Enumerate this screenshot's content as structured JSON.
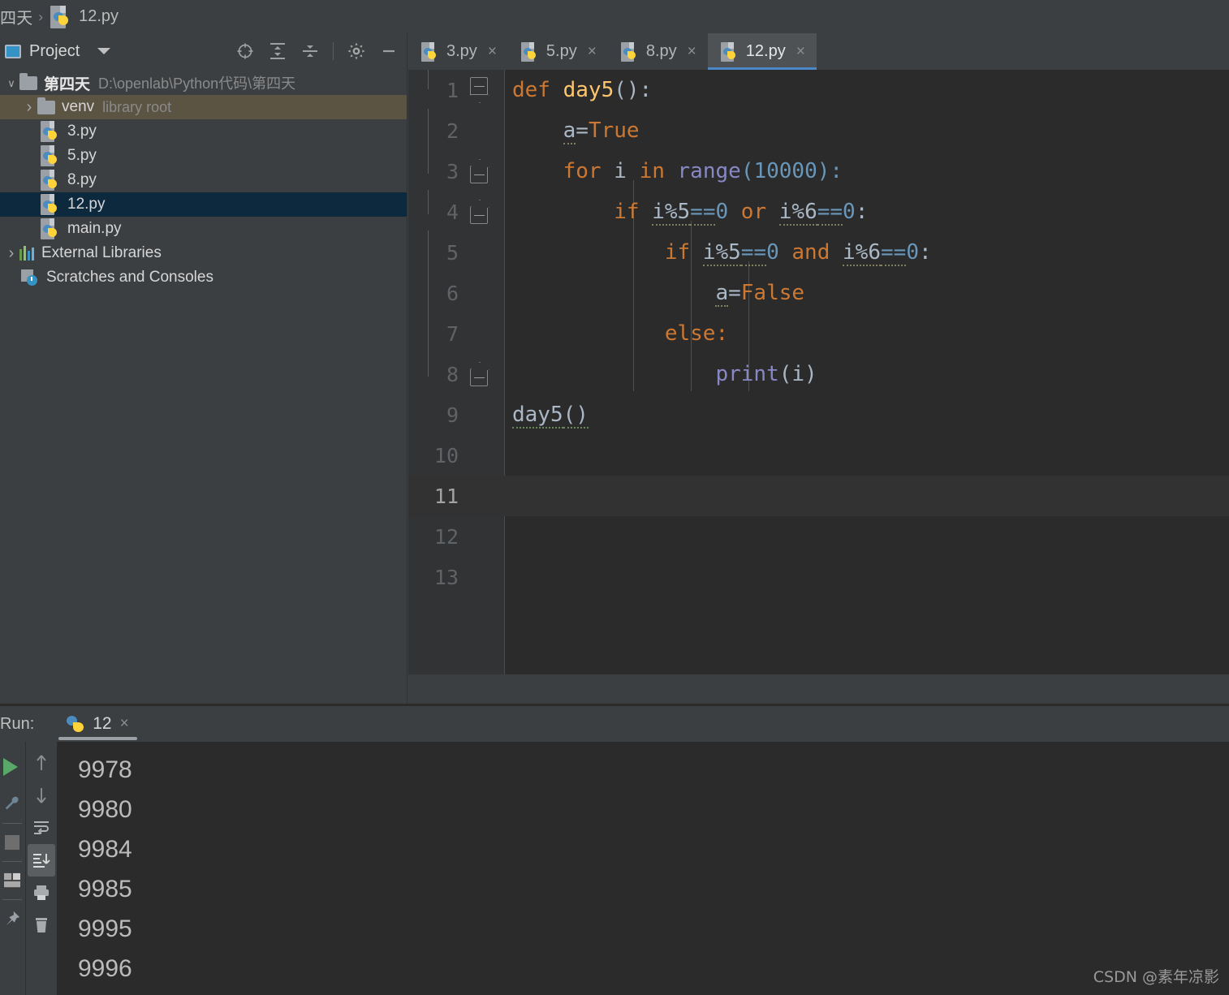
{
  "breadcrumb": {
    "folder": "四天",
    "separator": "›",
    "file": "12.py",
    "file_icon": "python-file-icon"
  },
  "project_panel": {
    "title": "Project",
    "window_icon": "project-window-icon",
    "caret_icon": "chevron-down-icon",
    "tools": [
      {
        "name": "locate-icon",
        "label": "Select Opened File"
      },
      {
        "name": "expand-all-icon",
        "label": "Expand All"
      },
      {
        "name": "collapse-all-icon",
        "label": "Collapse All"
      },
      {
        "name": "gear-icon",
        "label": "Settings"
      },
      {
        "name": "minimize-icon",
        "label": "Hide"
      }
    ],
    "tree": [
      {
        "label": "第四天",
        "detail": "D:\\openlab\\Python代码\\第四天",
        "icon": "folder-icon",
        "arrow": "down",
        "depth": 0,
        "bold": true,
        "state": "normal"
      },
      {
        "label": "venv",
        "detail": "library root",
        "icon": "folder-icon",
        "arrow": "right",
        "depth": 1,
        "bold": false,
        "state": "hover"
      },
      {
        "label": "3.py",
        "detail": "",
        "icon": "python-file-icon",
        "arrow": "none",
        "depth": 2,
        "bold": false,
        "state": "normal"
      },
      {
        "label": "5.py",
        "detail": "",
        "icon": "python-file-icon",
        "arrow": "none",
        "depth": 2,
        "bold": false,
        "state": "normal"
      },
      {
        "label": "8.py",
        "detail": "",
        "icon": "python-file-icon",
        "arrow": "none",
        "depth": 2,
        "bold": false,
        "state": "normal"
      },
      {
        "label": "12.py",
        "detail": "",
        "icon": "python-file-icon",
        "arrow": "none",
        "depth": 2,
        "bold": false,
        "state": "selected"
      },
      {
        "label": "main.py",
        "detail": "",
        "icon": "python-file-icon",
        "arrow": "none",
        "depth": 2,
        "bold": false,
        "state": "normal"
      },
      {
        "label": "External Libraries",
        "detail": "",
        "icon": "libraries-icon",
        "arrow": "right",
        "depth": 0,
        "bold": false,
        "state": "normal"
      },
      {
        "label": "Scratches and Consoles",
        "detail": "",
        "icon": "scratches-icon",
        "arrow": "none",
        "depth": 1,
        "bold": false,
        "state": "normal"
      }
    ]
  },
  "editor": {
    "tabs": [
      {
        "label": "3.py",
        "active": false,
        "close": "×"
      },
      {
        "label": "5.py",
        "active": false,
        "close": "×"
      },
      {
        "label": "8.py",
        "active": false,
        "close": "×"
      },
      {
        "label": "12.py",
        "active": true,
        "close": "×"
      }
    ],
    "caret_line": 11,
    "total_lines": 13,
    "line_numbers": [
      "1",
      "2",
      "3",
      "4",
      "5",
      "6",
      "7",
      "8",
      "9",
      "10",
      "11",
      "12",
      "13"
    ],
    "code": [
      {
        "n": "1",
        "text": "def day5():"
      },
      {
        "n": "2",
        "text": "    a=True"
      },
      {
        "n": "3",
        "text": "    for i in range(10000):"
      },
      {
        "n": "4",
        "text": "        if i%5==0 or i%6==0:"
      },
      {
        "n": "5",
        "text": "            if i%5==0 and i%6==0:"
      },
      {
        "n": "6",
        "text": "                a=False"
      },
      {
        "n": "7",
        "text": "            else:"
      },
      {
        "n": "8",
        "text": "                print(i)"
      },
      {
        "n": "9",
        "text": "day5()"
      },
      {
        "n": "10",
        "text": ""
      },
      {
        "n": "11",
        "text": ""
      },
      {
        "n": "12",
        "text": ""
      },
      {
        "n": "13",
        "text": ""
      }
    ],
    "tokens": {
      "t1_kw": "def",
      "t1_fn": "day5",
      "t1_p": "():",
      "t2_id": "a",
      "t2_eq": "=",
      "t2_kw": "True",
      "t3_kw1": "for",
      "t3_var": "i",
      "t3_kw2": "in",
      "t3_bi": "range",
      "t3_o": "(",
      "t3_num": "10000",
      "t3_c": "):",
      "t4_kw": "if",
      "t4_a": "i%5",
      "t4_eq": "==",
      "t4_z": "0",
      "t4_op": "or",
      "t4_b": "i%6",
      "t4_eq2": "==",
      "t4_z2": "0",
      "t4_colon": ":",
      "t5_kw": "if",
      "t5_a": "i%5",
      "t5_eq": "==",
      "t5_z": "0",
      "t5_op": "and",
      "t5_b": "i%6",
      "t5_eq2": "==",
      "t5_z2": "0",
      "t5_colon": ":",
      "t6_id": "a",
      "t6_eq": "=",
      "t6_kw": "False",
      "t7_kw": "else:",
      "t8_bi": "print",
      "t8_o": "(",
      "t8_var": "i",
      "t8_c": ")",
      "t9_fn": "day5",
      "t9_p": "()"
    }
  },
  "run_panel": {
    "label": "Run:",
    "tab_name": "12",
    "tab_icon": "python-icon",
    "tab_close": "×",
    "left_toolbar": [
      {
        "name": "run-button-icon",
        "label": "Run"
      },
      {
        "name": "wrench-icon",
        "label": "Edit Configuration"
      },
      {
        "name": "stop-icon",
        "label": "Stop"
      },
      {
        "name": "layout-icon",
        "label": "Layout"
      },
      {
        "name": "pin-icon",
        "label": "Pin Tab"
      }
    ],
    "console_toolbar": [
      {
        "name": "arrow-up-icon",
        "label": "Up the Stack Trace",
        "active": false
      },
      {
        "name": "arrow-down-icon",
        "label": "Down the Stack Trace",
        "active": false
      },
      {
        "name": "soft-wrap-icon",
        "label": "Soft-Wrap",
        "active": false
      },
      {
        "name": "scroll-to-end-icon",
        "label": "Scroll to End",
        "active": true
      },
      {
        "name": "print-icon",
        "label": "Print",
        "active": false
      },
      {
        "name": "trash-icon",
        "label": "Clear All",
        "active": false
      }
    ],
    "console_output": [
      "9978",
      "9980",
      "9984",
      "9985",
      "9995",
      "9996"
    ]
  },
  "watermark": "CSDN @素年凉影",
  "colors": {
    "panel_bg": "#3c3f41",
    "editor_bg": "#2b2b2b",
    "gutter_bg": "#313335",
    "selection": "#0d293e",
    "hover": "#5b5443",
    "accent": "#4a88c7",
    "keyword": "#cc7832",
    "function": "#ffc66d",
    "number": "#6897bb",
    "builtin": "#8888c6",
    "identifier": "#a9b7c6",
    "run_green": "#59a869"
  }
}
